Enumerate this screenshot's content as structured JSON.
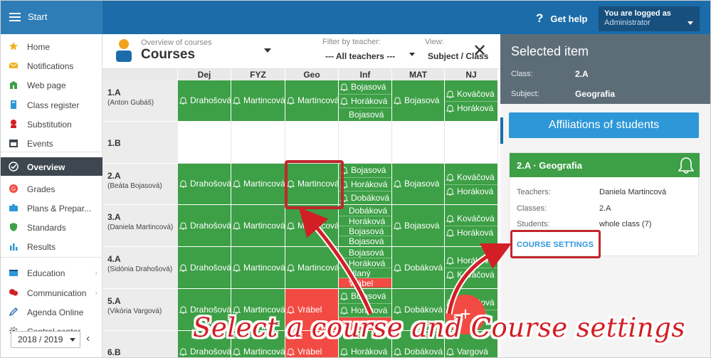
{
  "app": {
    "title": "Start",
    "help": "Get help",
    "user_line1": "You are logged as",
    "user_line2": "Administrator"
  },
  "sidebar": {
    "items": [
      {
        "label": "Home",
        "icon": "star-icon",
        "color": "#f2b01e"
      },
      {
        "label": "Notifications",
        "icon": "envelope-icon",
        "color": "#f2b01e"
      },
      {
        "label": "Web page",
        "icon": "building-icon",
        "color": "#3d9f46"
      },
      {
        "label": "Class register",
        "icon": "book-icon",
        "color": "#2e97d8"
      },
      {
        "label": "Substitution",
        "icon": "person-icon",
        "color": "#d21f26"
      },
      {
        "label": "Events",
        "icon": "calendar-icon",
        "color": "#3e464f"
      },
      {
        "label": "Overview",
        "icon": "check-circle-icon",
        "color": "#ffffff"
      },
      {
        "label": "Grades",
        "icon": "grade-icon",
        "color": "#f24b43"
      },
      {
        "label": "Plans & Prepar...",
        "icon": "briefcase-icon",
        "color": "#2e97d8"
      },
      {
        "label": "Standards",
        "icon": "shield-icon",
        "color": "#3d9f46"
      },
      {
        "label": "Results",
        "icon": "bar-chart-icon",
        "color": "#2e97d8"
      },
      {
        "label": "Education",
        "icon": "education-icon",
        "color": "#2e97d8"
      },
      {
        "label": "Communication",
        "icon": "chat-icon",
        "color": "#d21f26"
      },
      {
        "label": "Agenda Online",
        "icon": "pen-icon",
        "color": "#2e6fb5"
      },
      {
        "label": "Control center",
        "icon": "gear-icon",
        "color": "#777777"
      }
    ],
    "year": "2018 / 2019"
  },
  "courses": {
    "subtitle": "Overview of courses",
    "title": "Courses",
    "filter_label": "Filter by teacher:",
    "filter_value": "--- All teachers ---",
    "view_label": "View:",
    "view_value": "Subject / Class",
    "columns": [
      "Dej",
      "FYZ",
      "Geo",
      "Inf",
      "MAT",
      "NJ"
    ],
    "rows": [
      {
        "class": "1.A",
        "teacher": "(Anton Gubáš)",
        "cells": [
          {
            "s": "g",
            "e": [
              {
                "t": "Drahošová"
              }
            ]
          },
          {
            "s": "g",
            "e": [
              {
                "t": "Martincová"
              }
            ]
          },
          {
            "s": "g",
            "e": [
              {
                "t": "Martincová"
              }
            ]
          },
          {
            "s": "g",
            "e": [
              {
                "t": "Bojasová"
              },
              {
                "t": "Horáková"
              },
              {
                "t": "Bojasová",
                "nb": true
              }
            ]
          },
          {
            "s": "g",
            "e": [
              {
                "t": "Bojasová"
              }
            ]
          },
          {
            "s": "g",
            "e": [
              {
                "t": "Kováčová"
              },
              {
                "t": "Horáková"
              }
            ]
          }
        ]
      },
      {
        "class": "1.B",
        "teacher": "",
        "cells": [
          {
            "s": "w",
            "e": []
          },
          {
            "s": "w",
            "e": []
          },
          {
            "s": "w",
            "e": []
          },
          {
            "s": "w",
            "e": []
          },
          {
            "s": "w",
            "e": []
          },
          {
            "s": "w",
            "e": []
          }
        ]
      },
      {
        "class": "2.A",
        "teacher": "(Beáta Bojasová)",
        "cells": [
          {
            "s": "g",
            "e": [
              {
                "t": "Drahošová"
              }
            ]
          },
          {
            "s": "g",
            "e": [
              {
                "t": "Martincová"
              }
            ]
          },
          {
            "s": "g",
            "e": [
              {
                "t": "Martincová"
              }
            ]
          },
          {
            "s": "g",
            "e": [
              {
                "t": "Bojasová"
              },
              {
                "t": "Horáková"
              },
              {
                "t": "Dobáková"
              }
            ]
          },
          {
            "s": "g",
            "e": [
              {
                "t": "Bojasová"
              }
            ]
          },
          {
            "s": "g",
            "e": [
              {
                "t": "Kováčová"
              },
              {
                "t": "Horáková"
              }
            ]
          }
        ]
      },
      {
        "class": "3.A",
        "teacher": "(Daniela Martincová)",
        "cells": [
          {
            "s": "g",
            "e": [
              {
                "t": "Drahošová"
              }
            ]
          },
          {
            "s": "g",
            "e": [
              {
                "t": "Martincová"
              }
            ]
          },
          {
            "s": "g",
            "e": [
              {
                "t": "Martincová"
              }
            ]
          },
          {
            "s": "g",
            "e": [
              {
                "t": "Dobáková",
                "nb": true
              },
              {
                "t": "Horáková",
                "nb": true
              },
              {
                "t": "Bojasová",
                "nb": true
              },
              {
                "t": "Bojasová",
                "nb": true
              }
            ]
          },
          {
            "s": "g",
            "e": [
              {
                "t": "Bojasová"
              }
            ]
          },
          {
            "s": "g",
            "e": [
              {
                "t": "Kováčová"
              },
              {
                "t": "Horáková"
              }
            ]
          }
        ]
      },
      {
        "class": "4.A",
        "teacher": "(Sidónia Drahošová)",
        "cells": [
          {
            "s": "g",
            "e": [
              {
                "t": "Drahošová"
              }
            ]
          },
          {
            "s": "g",
            "e": [
              {
                "t": "Martincová"
              }
            ]
          },
          {
            "s": "g",
            "e": [
              {
                "t": "Martincová"
              }
            ]
          },
          {
            "s": "g",
            "e": [
              {
                "t": "Bojasová",
                "nb": true
              },
              {
                "t": "Horáková",
                "nb": true
              },
              {
                "t": "Hlaný",
                "nb": true
              },
              {
                "t": "Vrábel",
                "nb": true,
                "red": true
              }
            ]
          },
          {
            "s": "g",
            "e": [
              {
                "t": "Dobáková"
              }
            ]
          },
          {
            "s": "g",
            "e": [
              {
                "t": "Horáková"
              },
              {
                "t": "Kováčová"
              }
            ]
          }
        ]
      },
      {
        "class": "5.A",
        "teacher": "(Vikória Vargová)",
        "cells": [
          {
            "s": "g",
            "e": [
              {
                "t": "Drahošová"
              }
            ]
          },
          {
            "s": "g",
            "e": [
              {
                "t": "Martincová"
              }
            ]
          },
          {
            "s": "r",
            "e": [
              {
                "t": "Vrábel"
              }
            ]
          },
          {
            "s": "g",
            "e": [
              {
                "t": "Bojasová"
              },
              {
                "t": "Horáková"
              },
              {
                "t": "Vrábel",
                "red": true
              }
            ]
          },
          {
            "s": "g",
            "e": [
              {
                "t": "Dobáková"
              }
            ]
          },
          {
            "s": "g",
            "e": [
              {
                "t": "Kováčová"
              },
              {
                "t": "Vargová"
              }
            ]
          }
        ]
      },
      {
        "class": "6.B",
        "teacher": "",
        "cells": [
          {
            "s": "g",
            "e": [
              {
                "t": "Drahošová"
              }
            ]
          },
          {
            "s": "g",
            "e": [
              {
                "t": "Martincová"
              }
            ]
          },
          {
            "s": "r",
            "e": [
              {
                "t": "Vrábel"
              }
            ]
          },
          {
            "s": "g",
            "e": [
              {
                "t": "Horáková"
              }
            ]
          },
          {
            "s": "g",
            "e": [
              {
                "t": "Dobáková"
              }
            ]
          },
          {
            "s": "g",
            "e": [
              {
                "t": "Vargová"
              }
            ]
          }
        ]
      }
    ]
  },
  "selected": {
    "heading": "Selected item",
    "class_label": "Class:",
    "class_value": "2.A",
    "subject_label": "Subject:",
    "subject_value": "Geografia",
    "affiliations": "Affiliations of students",
    "card_title": "2.A · Geografia",
    "teachers_label": "Teachers:",
    "teachers_value": "Daniela Martincová",
    "classes_label": "Classes:",
    "classes_value": "2.A",
    "students_label": "Students:",
    "students_value": "whole class (7)",
    "settings": "COURSE SETTINGS"
  },
  "fab": "+",
  "caption": "Select a course and Course settings"
}
